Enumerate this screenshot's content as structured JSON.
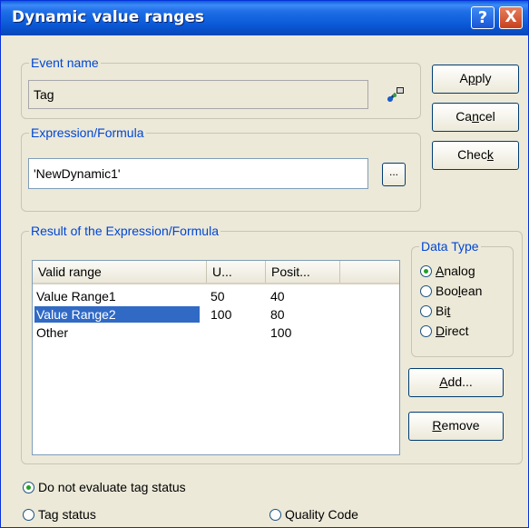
{
  "window": {
    "title": "Dynamic value ranges",
    "help_label": "?",
    "close_label": "X"
  },
  "event": {
    "legend": "Event name",
    "value": "Tag"
  },
  "expression": {
    "legend": "Expression/Formula",
    "value": "'NewDynamic1'",
    "browse_label": "..."
  },
  "buttons": {
    "apply": {
      "pre": "A",
      "key": "p",
      "post": "ply"
    },
    "cancel": {
      "pre": "Ca",
      "key": "n",
      "post": "cel"
    },
    "check": {
      "pre": "Chec",
      "key": "k",
      "post": ""
    },
    "add": {
      "pre": "",
      "key": "A",
      "post": "dd..."
    },
    "remove": {
      "pre": "",
      "key": "R",
      "post": "emove"
    }
  },
  "result": {
    "legend": "Result of the Expression/Formula",
    "columns": [
      "Valid range",
      "U...",
      "Posit..."
    ],
    "rows": [
      {
        "range": "Value Range1",
        "u": "50",
        "pos": "40",
        "selected": false
      },
      {
        "range": "Value Range2",
        "u": "100",
        "pos": "80",
        "selected": true
      },
      {
        "range": "Other",
        "u": "",
        "pos": "100",
        "selected": false
      }
    ]
  },
  "datatype": {
    "legend": "Data Type",
    "options": [
      {
        "pre": "",
        "key": "A",
        "post": "nalog",
        "checked": true
      },
      {
        "pre": "Boo",
        "key": "l",
        "post": "ean",
        "checked": false
      },
      {
        "pre": "Bi",
        "key": "t",
        "post": "",
        "checked": false
      },
      {
        "pre": "",
        "key": "D",
        "post": "irect",
        "checked": false
      }
    ]
  },
  "status": {
    "no_eval": "Do not evaluate tag status",
    "tag_status": "Tag status",
    "quality_code": "Quality Code"
  },
  "colors": {
    "selection": "#316ac5",
    "accent": "#0046d5"
  }
}
